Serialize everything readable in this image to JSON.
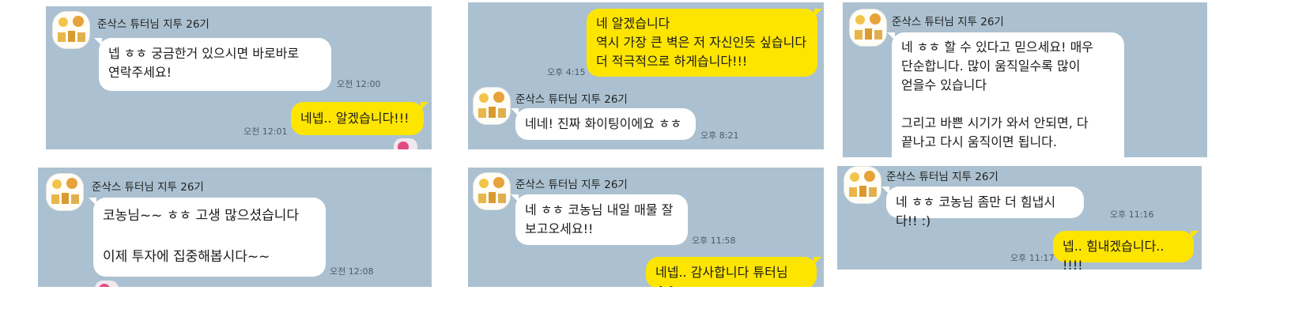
{
  "sender": "준삭스 튜터님 지투 26기",
  "panels": [
    {
      "messages": [
        {
          "text": "넵 ㅎㅎ 궁금한거 있으시면 바로바로\n연락주세요!",
          "time": "오전 12:00"
        },
        {
          "text": "네넵.. 알겠습니다!!!",
          "time": "오전 12:01"
        }
      ]
    },
    {
      "messages": [
        {
          "text": "네 알겠습니다\n역시 가장 큰 벽은 저 자신인듯 싶습니다\n더 적극적으로 하게습니다!!!",
          "time": "오후 4:15"
        },
        {
          "text": "네네! 진짜 화이팅이에요 ㅎㅎ",
          "time": "오후 8:21"
        }
      ]
    },
    {
      "messages": [
        {
          "text": "네 ㅎㅎ 할 수 있다고 믿으세요! 매우\n단순합니다. 많이 움직일수록 많이\n얻을수 있습니다\n\n그리고 바쁜 시기가 와서 안되면, 다\n끝나고 다시 움직이면 됩니다."
        }
      ]
    },
    {
      "messages": [
        {
          "text": "코농님~~ ㅎㅎ 고생 많으셨습니다\n\n이제 투자에 집중해봅시다~~",
          "time": "오전 12:08"
        }
      ]
    },
    {
      "messages": [
        {
          "text": "네 ㅎㅎ 코농님 내일 매물 잘\n보고오세요!!",
          "time": "오후 11:58"
        },
        {
          "text": "네넵.. 감사합니다 튜터님^^"
        }
      ]
    },
    {
      "messages": [
        {
          "text": "네 ㅎㅎ 코농님 좀만 더 힘냅시다!! :)",
          "time": "오후 11:16"
        },
        {
          "text": "넵.. 힘내겠습니다.. !!!!",
          "time": "오후 11:17"
        }
      ]
    }
  ],
  "colors": {
    "chat_background": "#abc1d1",
    "my_bubble": "#fee500",
    "their_bubble": "#ffffff",
    "reaction": "#e24a83"
  },
  "icons": [
    "profile-avatar",
    "heart-reaction-icon"
  ]
}
